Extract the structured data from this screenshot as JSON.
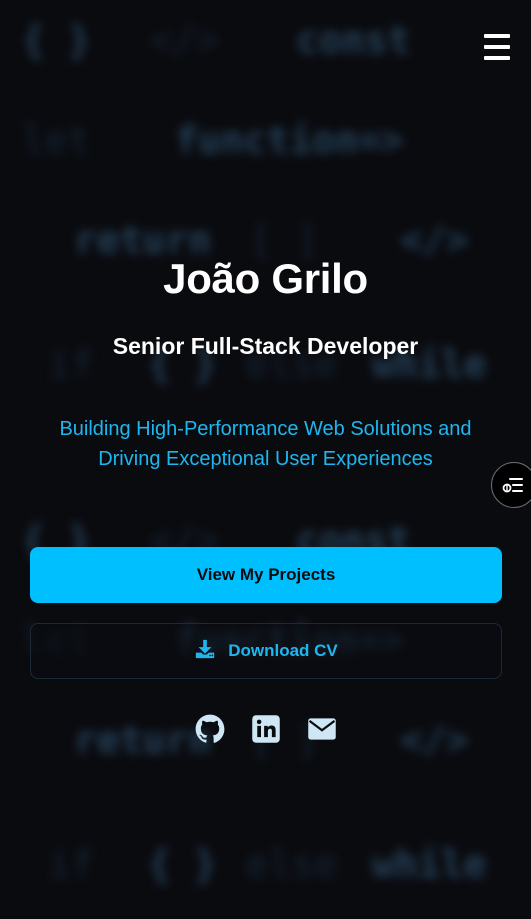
{
  "header": {
    "menu_icon": "hamburger-menu-icon"
  },
  "background_code_words": [
    "{ }",
    "</>",
    "const",
    "let",
    "function=>",
    "return",
    "[ ]",
    "</>",
    "if",
    "{ }",
    "else",
    "while",
    "{ }",
    "</>",
    "const",
    "let",
    "function=>",
    "return",
    "[ ]",
    "</>",
    "if",
    "{ }",
    "else",
    "while"
  ],
  "hero": {
    "name": "João Grilo",
    "role": "Senior Full-Stack Developer",
    "tagline": "Building High-Performance Web Solutions and Driving Exceptional User Experiences"
  },
  "actions": {
    "primary_label": "View My Projects",
    "secondary_label": "Download CV",
    "secondary_icon": "download-icon"
  },
  "socials": [
    {
      "icon": "github-icon"
    },
    {
      "icon": "linkedin-icon"
    },
    {
      "icon": "envelope-icon"
    }
  ],
  "side_toggle": {
    "icon": "accessibility-menu-icon"
  },
  "colors": {
    "background": "#0a0b0f",
    "accent": "#00bfff",
    "accent_text": "#1fb6f0",
    "text": "#ffffff"
  }
}
